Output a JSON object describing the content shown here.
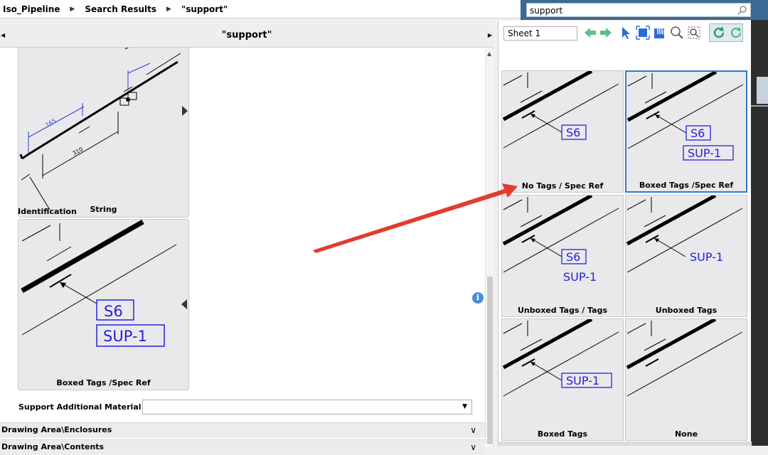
{
  "breadcrumb": [
    "Iso_Pipeline",
    "Search Results",
    "\"support\""
  ],
  "search": {
    "value": "support"
  },
  "left_panel": {
    "title": "\"support\"",
    "cards": [
      {
        "caption": "String",
        "dim_short": "165",
        "dim_long": "310"
      },
      {
        "caption": "Boxed Tags /Spec Ref",
        "tag_primary": "S6",
        "tag_secondary": "SUP-1"
      }
    ],
    "identification_label": "Identification",
    "support_additional_material": {
      "label": "Support Additional Material",
      "value": ""
    },
    "sections": [
      {
        "label": "Drawing Area\\Enclosures"
      },
      {
        "label": "Drawing Area\\Contents"
      }
    ]
  },
  "right_panel": {
    "sheet": "Sheet 1",
    "options": [
      {
        "caption": "No Tags / Spec Ref",
        "tag_primary": "S6",
        "tag_secondary": "",
        "boxed_primary": true,
        "boxed_secondary": false,
        "selected": false
      },
      {
        "caption": "Boxed Tags /Spec Ref",
        "tag_primary": "S6",
        "tag_secondary": "SUP-1",
        "boxed_primary": true,
        "boxed_secondary": true,
        "selected": true
      },
      {
        "caption": "Unboxed Tags / Tags",
        "tag_primary": "S6",
        "tag_secondary": "SUP-1",
        "boxed_primary": true,
        "boxed_secondary": false,
        "selected": false
      },
      {
        "caption": "Unboxed Tags",
        "tag_primary": "SUP-1",
        "tag_secondary": "",
        "boxed_primary": false,
        "boxed_secondary": false,
        "selected": false
      },
      {
        "caption": "Boxed Tags",
        "tag_primary": "SUP-1",
        "tag_secondary": "",
        "boxed_primary": true,
        "boxed_secondary": false,
        "selected": false
      },
      {
        "caption": "None",
        "tag_primary": "",
        "tag_secondary": "",
        "boxed_primary": false,
        "boxed_secondary": false,
        "selected": false
      }
    ]
  },
  "colors": {
    "accent": "#2b7cd3",
    "tag": "#2222dd",
    "annotation_arrow": "#e33b2e",
    "toolbar_green": "#5cc08a"
  }
}
